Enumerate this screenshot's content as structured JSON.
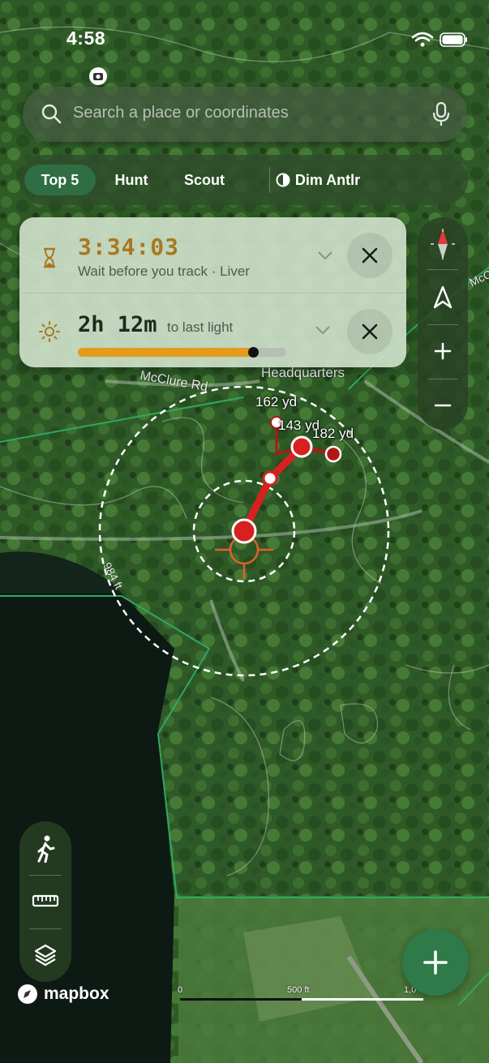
{
  "status_bar": {
    "time": "4:58"
  },
  "search": {
    "placeholder": "Search a place or coordinates"
  },
  "tabs": [
    {
      "label": "Top 5",
      "active": true
    },
    {
      "label": "Hunt",
      "active": false
    },
    {
      "label": "Scout",
      "active": false
    },
    {
      "label": "Dim Antlr",
      "active": false
    }
  ],
  "track_timer": {
    "value": "3:34:03",
    "subtitle": "Wait before you track · Liver",
    "icon": "hourglass-icon"
  },
  "last_light": {
    "hours": "2h",
    "minutes": "12m",
    "suffix": "to last light",
    "progress": 0.84,
    "icon": "sun-icon"
  },
  "map_labels": {
    "road": "McClure Rd",
    "place": "Headquarters",
    "elevation": "984 ft",
    "edge_road": "McC"
  },
  "track_points": [
    {
      "label": "162 yd"
    },
    {
      "label": "143 yd"
    },
    {
      "label": "182 yd"
    }
  ],
  "scale": {
    "start": "0",
    "mid": "500 ft",
    "end": "1,0"
  },
  "branding": {
    "name": "mapbox"
  },
  "colors": {
    "accent": "#2e6e42",
    "track": "#d92020",
    "timer": "#a87820",
    "progress": "#e69a1a",
    "boundary": "#2fa860"
  }
}
